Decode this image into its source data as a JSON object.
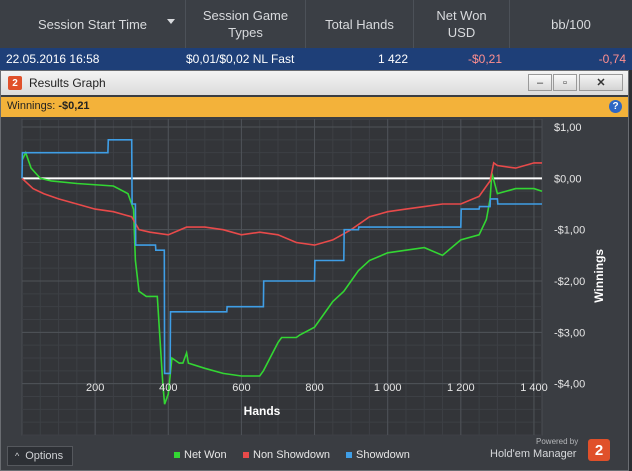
{
  "table": {
    "headers": [
      "Session Start Time",
      "Session Game Types",
      "Total Hands",
      "Net Won USD",
      "bb/100"
    ],
    "sort_icon": "triangle-down-icon",
    "row": {
      "start_time": "22.05.2016 16:58",
      "game_type": "$0,01/$0,02 NL Fast",
      "total_hands": "1 422",
      "net_won": "-$0,21",
      "bb100": "-0,74",
      "negative_color": "#ff8f8f"
    }
  },
  "window": {
    "title": "Results Graph",
    "logo_glyph": "2",
    "minimize": "–",
    "restore": "▫",
    "close": "✕",
    "winnings_label": "Winnings:",
    "winnings_value": "-$0,21",
    "help_glyph": "?"
  },
  "chart_data": {
    "type": "line",
    "xlabel": "Hands",
    "ylabel": "Winnings",
    "xlim": [
      0,
      1422
    ],
    "ylim": [
      -5.0,
      1.0
    ],
    "x_ticks": [
      "200",
      "400",
      "600",
      "800",
      "1 000",
      "1 200",
      "1 400"
    ],
    "x_tick_values": [
      200,
      400,
      600,
      800,
      1000,
      1200,
      1400
    ],
    "y_ticks": [
      "$1,00",
      "$0,00",
      "-$1,00",
      "-$2,00",
      "-$3,00",
      "-$4,00"
    ],
    "y_tick_values": [
      1,
      0,
      -1,
      -2,
      -3,
      -4
    ],
    "grid": true,
    "series": [
      {
        "name": "Net Won",
        "color": "#33d633",
        "x": [
          0,
          10,
          25,
          50,
          80,
          150,
          250,
          290,
          305,
          310,
          320,
          340,
          370,
          385,
          390,
          400,
          410,
          430,
          440,
          450,
          455,
          500,
          550,
          600,
          650,
          660,
          700,
          710,
          750,
          760,
          800,
          820,
          850,
          880,
          900,
          920,
          950,
          1000,
          1050,
          1100,
          1150,
          1200,
          1250,
          1270,
          1280,
          1285,
          1300,
          1350,
          1400,
          1422
        ],
        "y": [
          0.35,
          0.5,
          0.2,
          0.0,
          -0.05,
          -0.1,
          -0.15,
          -0.3,
          -0.6,
          -1.6,
          -2.2,
          -2.3,
          -2.3,
          -4.0,
          -4.4,
          -4.2,
          -3.5,
          -3.6,
          -3.6,
          -3.4,
          -3.6,
          -3.7,
          -3.8,
          -3.85,
          -3.85,
          -3.75,
          -3.2,
          -3.1,
          -3.1,
          -3.05,
          -2.9,
          -2.7,
          -2.4,
          -2.2,
          -2.0,
          -1.8,
          -1.6,
          -1.45,
          -1.4,
          -1.35,
          -1.5,
          -1.2,
          -1.1,
          -0.8,
          -0.4,
          0.1,
          -0.3,
          -0.2,
          -0.2,
          -0.25
        ]
      },
      {
        "name": "Non Showdown",
        "color": "#e84a4a",
        "x": [
          0,
          30,
          60,
          100,
          150,
          200,
          250,
          300,
          320,
          350,
          400,
          450,
          500,
          550,
          600,
          650,
          700,
          750,
          800,
          850,
          900,
          950,
          1000,
          1050,
          1100,
          1150,
          1200,
          1250,
          1280,
          1290,
          1300,
          1350,
          1400,
          1422
        ],
        "y": [
          0.0,
          -0.2,
          -0.3,
          -0.4,
          -0.5,
          -0.6,
          -0.65,
          -0.75,
          -1.0,
          -1.05,
          -1.1,
          -0.95,
          -0.95,
          -1.0,
          -1.1,
          -1.05,
          -1.1,
          -1.25,
          -1.3,
          -1.2,
          -1.0,
          -0.75,
          -0.65,
          -0.6,
          -0.55,
          -0.5,
          -0.5,
          -0.35,
          -0.05,
          0.3,
          0.25,
          0.2,
          0.3,
          0.3
        ]
      },
      {
        "name": "Showdown",
        "color": "#3f9ee6",
        "x": [
          0,
          1,
          235,
          236,
          300,
          301,
          310,
          311,
          365,
          366,
          389,
          390,
          405,
          406,
          560,
          561,
          660,
          661,
          800,
          801,
          880,
          881,
          920,
          921,
          1200,
          1201,
          1250,
          1251,
          1280,
          1281,
          1300,
          1301,
          1422
        ],
        "y": [
          0.0,
          0.5,
          0.5,
          0.75,
          0.75,
          -0.5,
          -0.5,
          -1.3,
          -1.3,
          -1.4,
          -1.4,
          -3.8,
          -3.8,
          -2.6,
          -2.6,
          -2.5,
          -2.5,
          -2.0,
          -2.0,
          -1.6,
          -1.6,
          -1.0,
          -1.0,
          -0.95,
          -0.95,
          -0.6,
          -0.6,
          -0.55,
          -0.55,
          -0.4,
          -0.4,
          -0.5,
          -0.5
        ]
      }
    ]
  },
  "footer": {
    "options_label": "Options",
    "options_icon": "chevron-up-icon",
    "powered_by": "Powered by",
    "brand": "Hold'em Manager",
    "brand_glyph": "2"
  }
}
